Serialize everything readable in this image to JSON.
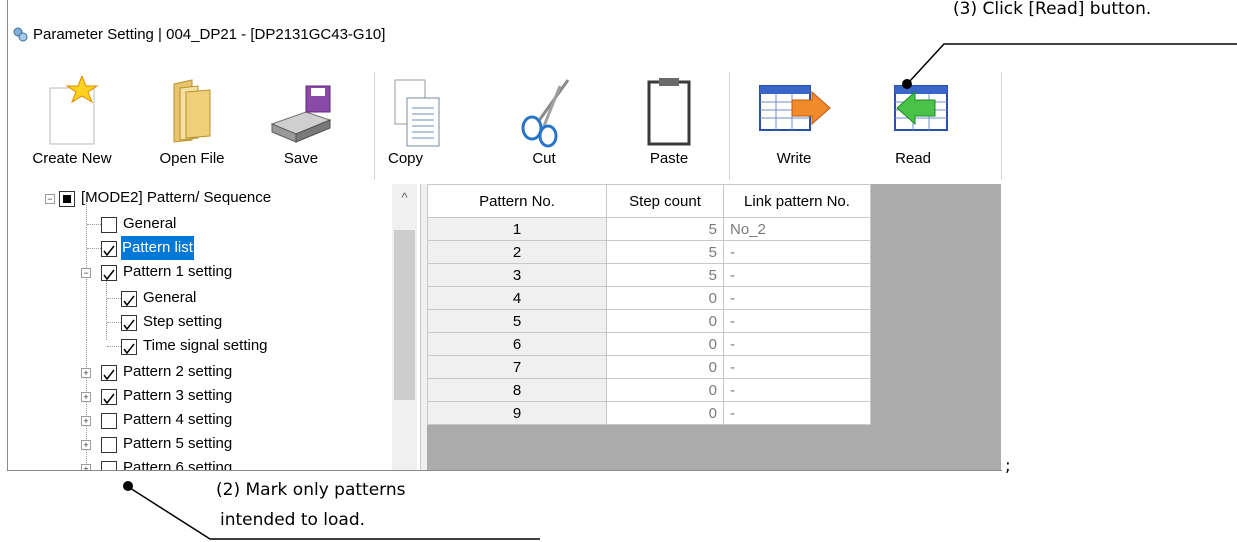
{
  "window": {
    "title": "Parameter Setting  |  004_DP21 - [DP2131GC43-G10]"
  },
  "toolbar": {
    "create_new": "Create New",
    "open_file": "Open File",
    "save": "Save",
    "copy": "Copy",
    "cut": "Cut",
    "paste": "Paste",
    "write": "Write",
    "read": "Read"
  },
  "tree": {
    "root": "[MODE2] Pattern/ Sequence",
    "general": "General",
    "pattern_list": "Pattern list",
    "p1": "Pattern 1 setting",
    "p1_general": "General",
    "p1_step": "Step setting",
    "p1_time": "Time signal setting",
    "p2": "Pattern 2 setting",
    "p3": "Pattern 3 setting",
    "p4": "Pattern 4 setting",
    "p5": "Pattern 5 setting",
    "p6": "Pattern 6 setting"
  },
  "grid": {
    "headers": [
      "Pattern No.",
      "Step count",
      "Link pattern No."
    ],
    "rows": [
      [
        "1",
        "5",
        "No_2"
      ],
      [
        "2",
        "5",
        "-"
      ],
      [
        "3",
        "5",
        "-"
      ],
      [
        "4",
        "0",
        "-"
      ],
      [
        "5",
        "0",
        "-"
      ],
      [
        "6",
        "0",
        "-"
      ],
      [
        "7",
        "0",
        "-"
      ],
      [
        "8",
        "0",
        "-"
      ],
      [
        "9",
        "0",
        "-"
      ]
    ]
  },
  "annotations": {
    "read_hint": "(3) Click [Read] button.",
    "mark_hint_1": "(2) Mark only patterns",
    "mark_hint_2": "intended to load.",
    "stray": ";"
  }
}
